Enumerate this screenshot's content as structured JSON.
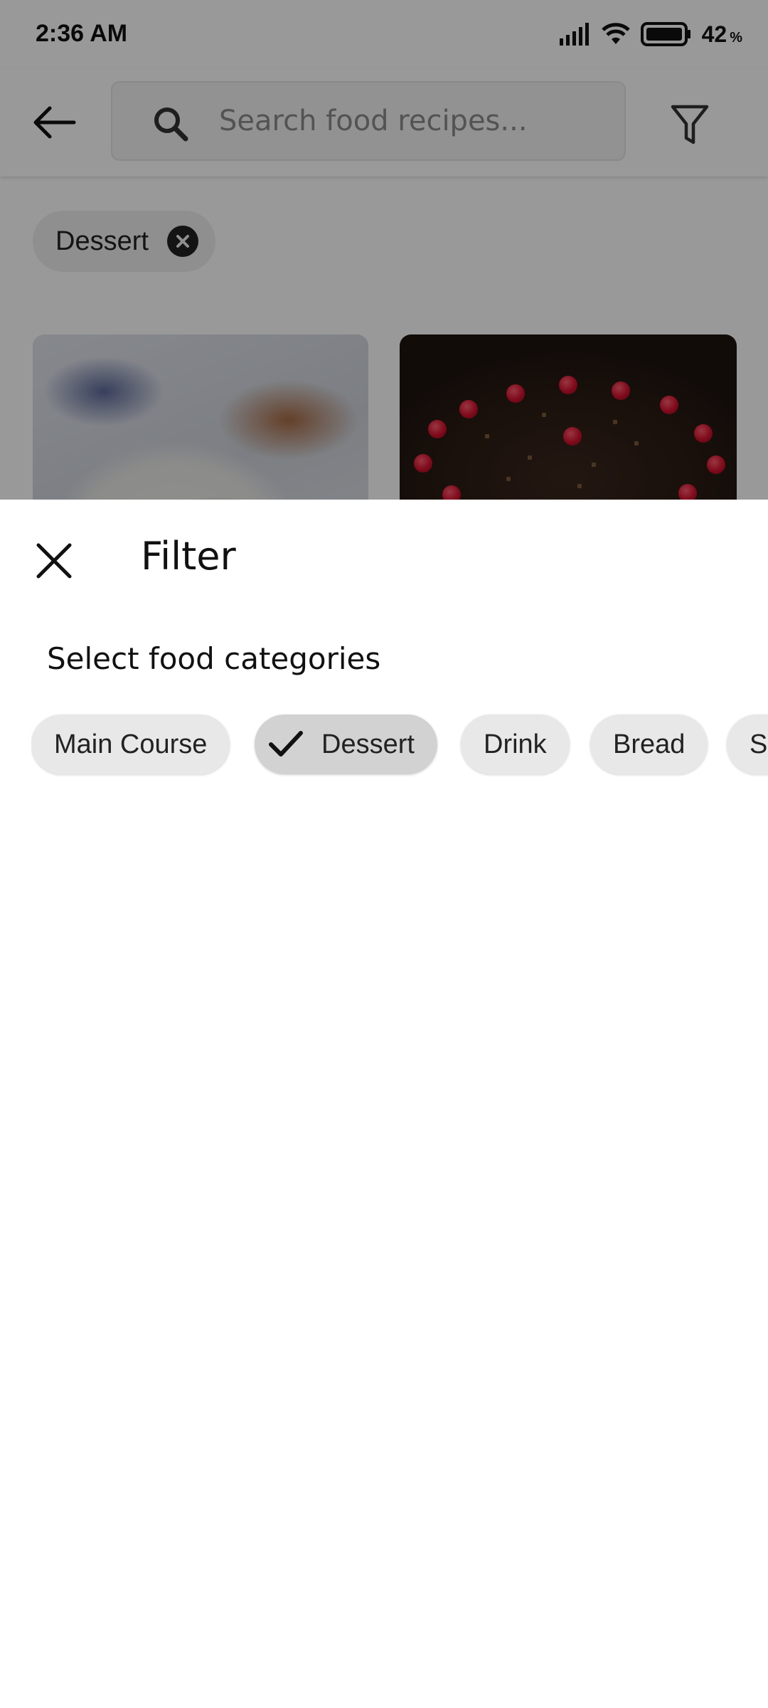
{
  "status_bar": {
    "time": "2:36 AM",
    "battery_percent": "42",
    "battery_unit": "%",
    "icons": [
      "signal-icon",
      "wifi-icon",
      "battery-icon"
    ]
  },
  "app_bar": {
    "search_placeholder": "Search food recipes...",
    "back_icon": "arrow-left-icon",
    "filter_icon": "filter-icon"
  },
  "active_filters": [
    {
      "label": "Dessert"
    }
  ],
  "filter_sheet": {
    "title": "Filter",
    "section_label": "Select food categories",
    "categories": [
      {
        "label": "Main Course",
        "selected": false
      },
      {
        "label": "Dessert",
        "selected": true
      },
      {
        "label": "Drink",
        "selected": false
      },
      {
        "label": "Bread",
        "selected": false
      },
      {
        "label": "Side Dish",
        "selected": false
      }
    ]
  },
  "colors": {
    "scrim": "#000000",
    "chip_background": "#e8e8e8",
    "chip_selected_background": "#d2d2d2",
    "text_primary": "#111111"
  }
}
